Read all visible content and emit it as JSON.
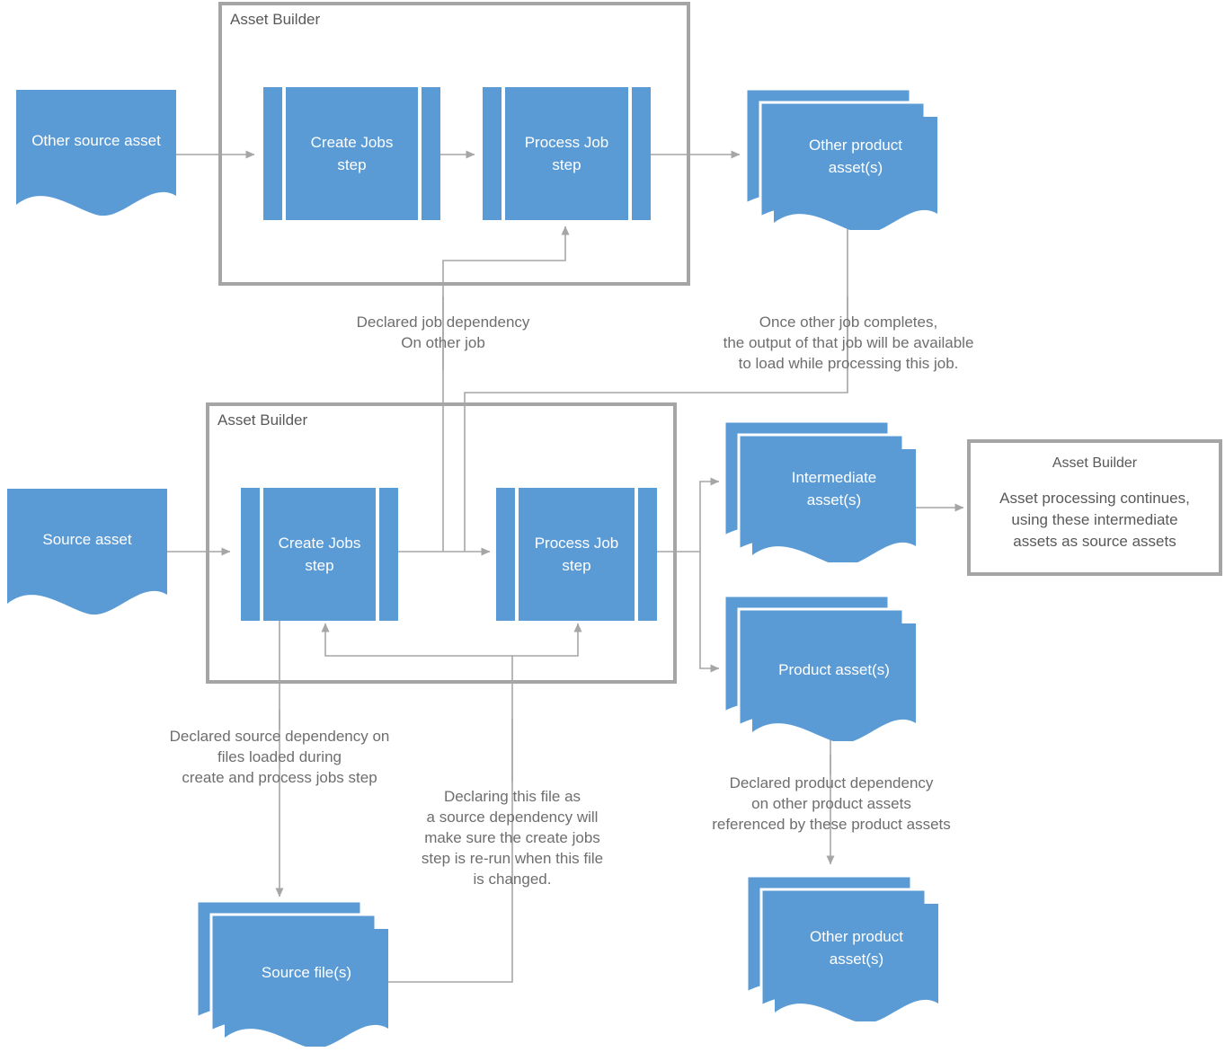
{
  "diagram": {
    "title": "Asset Builder job and dependency flow",
    "colors": {
      "asset_fill": "#5B9BD5",
      "container_border": "#A5A5A5",
      "connector": "#A6A6A6",
      "note_text": "#6E6E6E",
      "title_text": "#595959",
      "asset_text": "#FFFFFF",
      "background": "#FFFFFF"
    }
  },
  "containers": [
    {
      "id": "builder_top",
      "title": "Asset Builder"
    },
    {
      "id": "builder_bottom",
      "title": "Asset Builder"
    }
  ],
  "steps": [
    {
      "id": "top_create",
      "label": "Create Jobs\nstep"
    },
    {
      "id": "top_process",
      "label": "Process Job\nstep"
    },
    {
      "id": "bottom_create",
      "label": "Create Jobs\nstep"
    },
    {
      "id": "bottom_process",
      "label": "Process Job\nstep"
    }
  ],
  "assets": [
    {
      "id": "other_source_asset",
      "label": "Other source asset",
      "stacked": false
    },
    {
      "id": "other_product_assets_top",
      "label": "Other product\nasset(s)",
      "stacked": true
    },
    {
      "id": "source_asset",
      "label": "Source asset",
      "stacked": false
    },
    {
      "id": "intermediate_assets",
      "label": "Intermediate\nasset(s)",
      "stacked": true
    },
    {
      "id": "product_assets",
      "label": "Product asset(s)",
      "stacked": true
    },
    {
      "id": "source_files",
      "label": "Source file(s)",
      "stacked": true
    },
    {
      "id": "other_product_assets_bottom",
      "label": "Other product\nasset(s)",
      "stacked": true
    }
  ],
  "notes": [
    {
      "id": "note_job_dependency",
      "text": "Declared job dependency\nOn other job"
    },
    {
      "id": "note_once_other_job",
      "text": "Once other job completes,\nthe output of that job will be available\nto load while processing this job."
    },
    {
      "id": "note_source_dependency",
      "text": "Declared source dependency on\nfiles loaded during\ncreate and process jobs step"
    },
    {
      "id": "note_declaring_file",
      "text": "Declaring this file as\na source dependency will\nmake sure the create jobs\nstep is re-run when this file\nis changed."
    },
    {
      "id": "note_product_dependency",
      "text": "Declared product dependency\non other product assets\nreferenced by these product assets"
    }
  ],
  "callout": {
    "id": "asset_builder_callout",
    "title": "Asset Builder",
    "body": "Asset processing continues,\nusing these intermediate\nassets as source assets"
  }
}
